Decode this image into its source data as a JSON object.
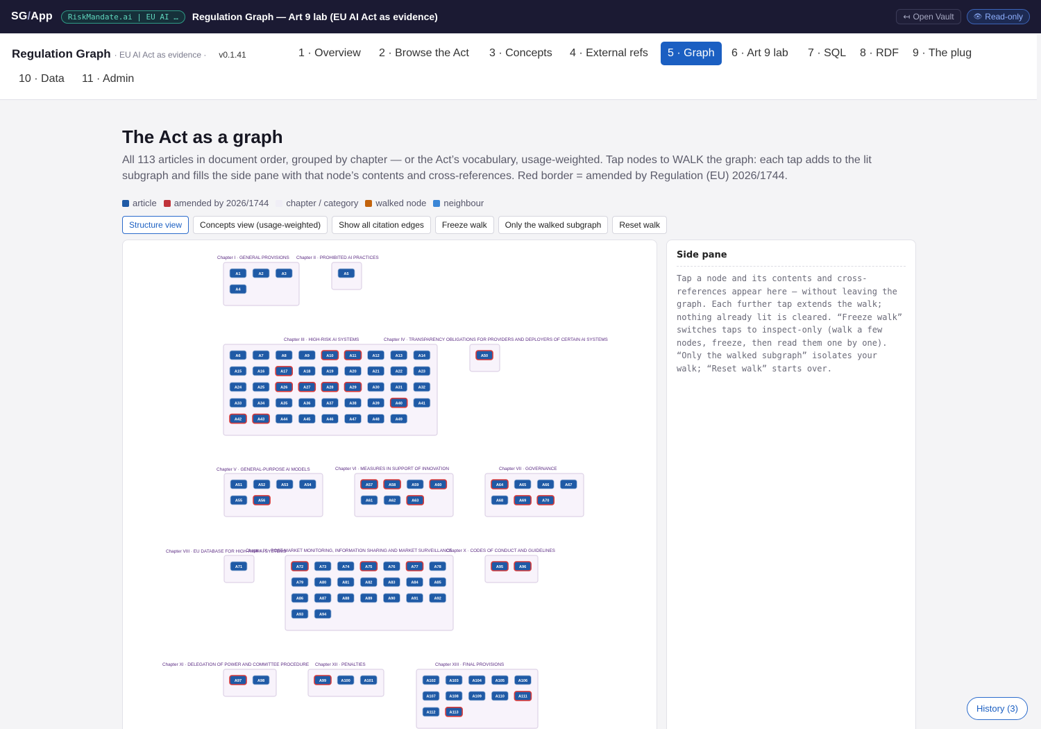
{
  "topbar": {
    "app_logo_prefix": "SG",
    "app_logo_slash": "/",
    "app_logo_suffix": "App",
    "vault_pill": "RiskMandate.ai | EU AI …",
    "title": "Regulation Graph — Art 9 lab (EU AI Act as evidence)",
    "open_vault_icon": "↤",
    "open_vault": "Open Vault",
    "read_only_icon": "👁",
    "read_only": "Read-only"
  },
  "nav": {
    "brand_title": "Regulation Graph",
    "brand_sub": "· EU AI Act as evidence ·",
    "version": "v0.1.41",
    "tabs": [
      {
        "label": "1 · Overview",
        "active": false
      },
      {
        "label": "2 · Browse the Act",
        "active": false
      },
      {
        "label": "3 · Concepts",
        "active": false
      },
      {
        "label": "4 · External refs",
        "active": false
      },
      {
        "label": "5 · Graph",
        "active": true
      },
      {
        "label": "6 · Art 9 lab",
        "active": false
      },
      {
        "label": "7 · SQL",
        "active": false
      },
      {
        "label": "8 · RDF",
        "active": false
      },
      {
        "label": "9 · The plug",
        "active": false
      },
      {
        "label": "10 · Data",
        "active": false
      },
      {
        "label": "11 · Admin",
        "active": false
      }
    ]
  },
  "main": {
    "title": "The Act as a graph",
    "description": "All 113 articles in document order, grouped by chapter — or the Act’s vocabulary, usage-weighted. Tap nodes to WALK the graph: each tap adds to the lit subgraph and fills the side pane with that node’s contents and cross-references. Red border = amended by Regulation (EU) 2026/1744."
  },
  "legend": [
    {
      "label": "article",
      "color": "#1f5aa6"
    },
    {
      "label": "amended by 2026/1744",
      "color": "#c0333a"
    },
    {
      "label": "chapter / category",
      "color": "#f0eef6"
    },
    {
      "label": "walked node",
      "color": "#c2630c"
    },
    {
      "label": "neighbour",
      "color": "#3a86d6"
    }
  ],
  "toolbar": [
    {
      "label": "Structure view",
      "active": true
    },
    {
      "label": "Concepts view (usage-weighted)",
      "active": false
    },
    {
      "label": "Show all citation edges",
      "active": false
    },
    {
      "label": "Freeze walk",
      "active": false
    },
    {
      "label": "Only the walked subgraph",
      "active": false
    },
    {
      "label": "Reset walk",
      "active": false
    }
  ],
  "colors": {
    "article": "#1f5aa6",
    "amended_border": "#d63a3a",
    "chapter_fill": "#f8f3fb",
    "chapter_border": "#ddd2e6",
    "chapter_label": "#5a2a82"
  },
  "graph": {
    "chapters": [
      {
        "label": "Chapter I · GENERAL PROVISIONS",
        "articles": [
          1,
          2,
          3,
          4
        ],
        "amended": []
      },
      {
        "label": "Chapter II · PROHIBITED AI PRACTICES",
        "articles": [
          5
        ],
        "amended": []
      },
      {
        "label": "Chapter III · HIGH-RISK AI SYSTEMS",
        "articles": [
          6,
          7,
          8,
          9,
          10,
          11,
          12,
          13,
          14,
          15,
          16,
          17,
          18,
          19,
          20,
          21,
          22,
          23,
          24,
          25,
          26,
          27,
          28,
          29,
          30,
          31,
          32,
          33,
          34,
          35,
          36,
          37,
          38,
          39,
          40,
          41,
          42,
          43,
          44,
          45,
          46,
          47,
          48,
          49
        ],
        "amended": [
          10,
          11,
          17,
          26,
          27,
          28,
          29,
          40,
          42,
          43
        ]
      },
      {
        "label": "Chapter IV · TRANSPARENCY OBLIGATIONS FOR PROVIDERS AND DEPLOYERS OF CERTAIN AI SYSTEMS",
        "articles": [
          50
        ],
        "amended": [
          50
        ]
      },
      {
        "label": "Chapter V · GENERAL-PURPOSE AI MODELS",
        "articles": [
          51,
          52,
          53,
          54,
          55,
          56
        ],
        "amended": [
          56
        ]
      },
      {
        "label": "Chapter VI · MEASURES IN SUPPORT OF INNOVATION",
        "articles": [
          57,
          58,
          59,
          60,
          61,
          62,
          63
        ],
        "amended": [
          57,
          58,
          60,
          63
        ]
      },
      {
        "label": "Chapter VII · GOVERNANCE",
        "articles": [
          64,
          65,
          66,
          67,
          68,
          69,
          70
        ],
        "amended": [
          64,
          69,
          70
        ]
      },
      {
        "label": "Chapter VIII · EU DATABASE FOR HIGH-RISK AI SYSTEMS",
        "articles": [
          71
        ],
        "amended": []
      },
      {
        "label": "Chapter IX · POST-MARKET MONITORING, INFORMATION SHARING AND MARKET SURVEILLANCE",
        "articles": [
          72,
          73,
          74,
          75,
          76,
          77,
          78,
          79,
          80,
          81,
          82,
          83,
          84,
          85,
          86,
          87,
          88,
          89,
          90,
          91,
          92,
          93,
          94
        ],
        "amended": [
          72,
          75,
          77
        ]
      },
      {
        "label": "Chapter X · CODES OF CONDUCT AND GUIDELINES",
        "articles": [
          95,
          96
        ],
        "amended": [
          95,
          96
        ]
      },
      {
        "label": "Chapter XI · DELEGATION OF POWER AND COMMITTEE PROCEDURE",
        "articles": [
          97,
          98
        ],
        "amended": [
          97
        ]
      },
      {
        "label": "Chapter XII · PENALTIES",
        "articles": [
          99,
          100,
          101
        ],
        "amended": [
          99
        ]
      },
      {
        "label": "Chapter XIII · FINAL PROVISIONS",
        "articles": [
          102,
          103,
          104,
          105,
          106,
          107,
          108,
          109,
          110,
          111,
          112,
          113
        ],
        "amended": [
          111,
          113
        ]
      }
    ]
  },
  "side": {
    "title": "Side pane",
    "text": "Tap a node and its contents and cross-references appear here — without leaving the graph. Each further tap extends the walk; nothing already lit is cleared. “Freeze walk” switches taps to inspect-only (walk a few nodes, freeze, then read them one by one). “Only the walked subgraph” isolates your walk; “Reset walk” starts over."
  },
  "history": {
    "label": "History (3)"
  }
}
